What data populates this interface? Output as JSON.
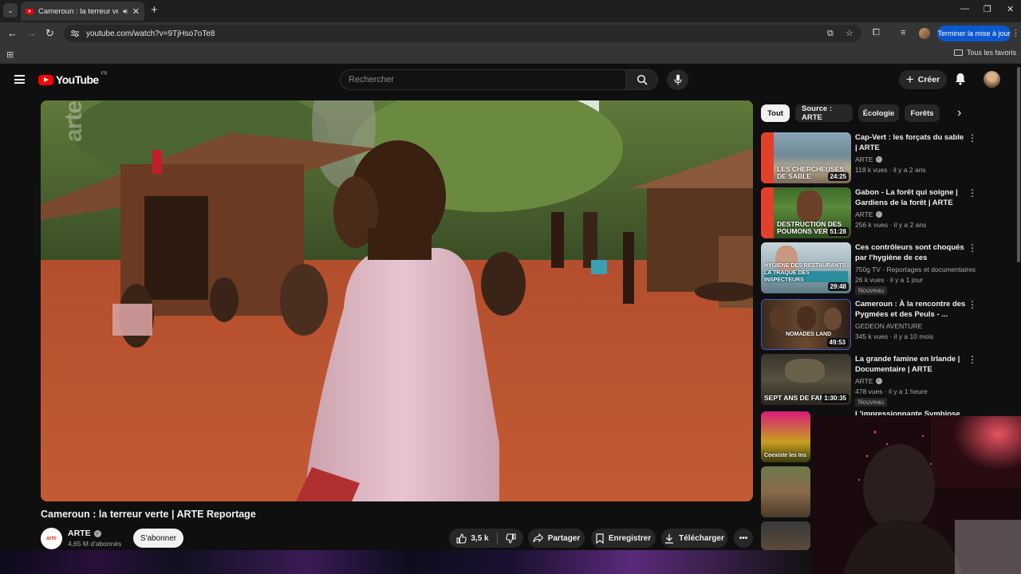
{
  "browser": {
    "tab_title": "Cameroun : la terreur verte",
    "url": "youtube.com/watch?v=9TjHso7oTe8",
    "update_button": "Terminer la mise à jour",
    "all_bookmarks": "Tous les favoris"
  },
  "header": {
    "logo_text": "YouTube",
    "country_code": "FR",
    "search_placeholder": "Rechercher",
    "create_label": "Créer"
  },
  "video": {
    "title": "Cameroun : la terreur verte | ARTE Reportage",
    "watermark": "arte",
    "channel": {
      "name": "ARTE",
      "avatar_text": "arte",
      "subscribers": "4,65 M d'abonnés",
      "subscribe_label": "S'abonner"
    },
    "actions": {
      "likes": "3,5 k",
      "share": "Partager",
      "save": "Enregistrer",
      "download": "Télécharger"
    }
  },
  "chips": [
    "Tout",
    "Source : ARTE",
    "Écologie",
    "Forêts"
  ],
  "recommendations": [
    {
      "title": "Cap-Vert : les forçats du sable | ARTE",
      "channel": "ARTE",
      "verified": true,
      "meta": "118 k vues · il y a 2 ans",
      "duration": "24:25",
      "thumb_text": "LES CHERCHEUSES DE SABLE",
      "badge": ""
    },
    {
      "title": "Gabon - La forêt qui soigne | Gardiens de la forêt | ARTE",
      "channel": "ARTE",
      "verified": true,
      "meta": "256 k vues · il y a 2 ans",
      "duration": "51:28",
      "thumb_text": "DESTRUCTION DES POUMONS VERTS",
      "badge": ""
    },
    {
      "title": "Ces contrôleurs sont choqués par l'hygiène de ces restaurant...",
      "channel": "750g TV - Reportages et documentaires",
      "verified": false,
      "meta": "26 k vues · il y a 1 jour",
      "duration": "29:48",
      "thumb_text": "HYGIÈNE DES RESTAURANTS LA TRAQUE DES INSPECTEURS",
      "badge": "Nouveau"
    },
    {
      "title": "Cameroun : À la rencontre des Pygmées et des Peuls - ...",
      "channel": "GEDEON AVENTURE",
      "verified": false,
      "meta": "345 k vues · il y a 10 mois",
      "duration": "49:53",
      "thumb_text": "NOMADES LAND",
      "badge": ""
    },
    {
      "title": "La grande famine en Irlande | Documentaire | ARTE",
      "channel": "ARTE",
      "verified": true,
      "meta": "478 vues · il y a 1 heure",
      "duration": "1:30:35",
      "thumb_text": "SEPT ANS DE FAMINE",
      "badge": "Nouveau"
    },
    {
      "title": "L'impressionnante Symbiose du ...",
      "channel": "",
      "verified": false,
      "meta": "",
      "duration": "",
      "thumb_text": "Coexiste les Ins",
      "badge": ""
    }
  ]
}
